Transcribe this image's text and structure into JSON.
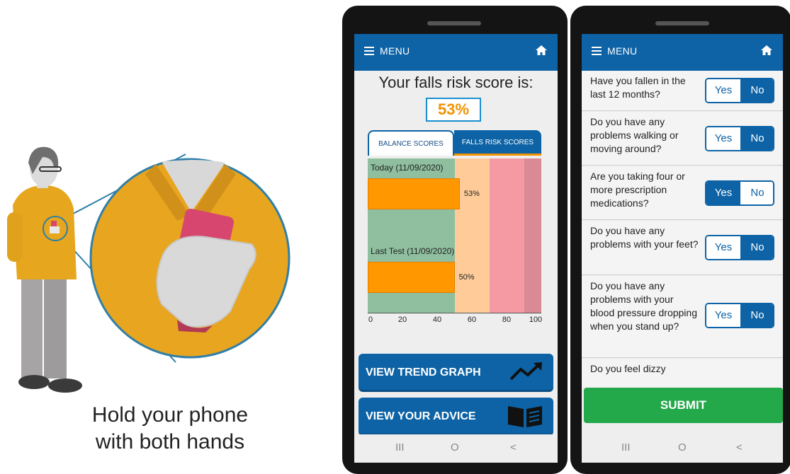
{
  "illustration": {
    "caption_line1": "Hold your phone",
    "caption_line2": "with both hands"
  },
  "phone1": {
    "appbar": {
      "menu_label": "MENU"
    },
    "title": "Your falls risk score is:",
    "score": "53%",
    "tabs": [
      {
        "label": "BALANCE SCORES",
        "active": false
      },
      {
        "label": "FALLS RISK SCORES",
        "active": true
      }
    ],
    "chart_data": {
      "type": "bar",
      "orientation": "horizontal",
      "categories": [
        "Today (11/09/2020)",
        "Last Test (11/09/2020)"
      ],
      "values": [
        53,
        50
      ],
      "value_labels": [
        "53%",
        "50%"
      ],
      "xlim": [
        0,
        100
      ],
      "xticks": [
        "0",
        "20",
        "40",
        "60",
        "80",
        "100"
      ],
      "bands": [
        {
          "from": 0,
          "to": 50,
          "color": "#8fbf9f"
        },
        {
          "from": 50,
          "to": 70,
          "color": "#ffcc99"
        },
        {
          "from": 70,
          "to": 90,
          "color": "#f59aa2"
        },
        {
          "from": 90,
          "to": 100,
          "color": "#d98a94"
        }
      ],
      "bar_color": "#ff9800"
    },
    "buttons": {
      "trend": "VIEW TREND GRAPH",
      "advice": "VIEW YOUR ADVICE"
    },
    "navbar": {
      "recent": "III",
      "home": "O",
      "back": "<"
    }
  },
  "phone2": {
    "appbar": {
      "menu_label": "MENU"
    },
    "questions": [
      {
        "text": "Have you fallen in the last 12 months?",
        "yes": "Yes",
        "no": "No",
        "selected": "no"
      },
      {
        "text": "Do you have any problems walking or moving around?",
        "yes": "Yes",
        "no": "No",
        "selected": "no"
      },
      {
        "text": "Are you taking four or more prescription medications?",
        "yes": "Yes",
        "no": "No",
        "selected": "yes"
      },
      {
        "text": "Do you have any problems with your feet?",
        "yes": "Yes",
        "no": "No",
        "selected": "no"
      },
      {
        "text": "Do you have any problems with your blood pressure dropping when you stand up?",
        "yes": "Yes",
        "no": "No",
        "selected": "no"
      },
      {
        "text": "Do you feel dizzy"
      }
    ],
    "submit_label": "SUBMIT",
    "navbar": {
      "recent": "III",
      "home": "O",
      "back": "<"
    }
  },
  "colors": {
    "brand_blue": "#0d63a5",
    "accent_orange": "#f39200",
    "submit_green": "#23a84a"
  }
}
